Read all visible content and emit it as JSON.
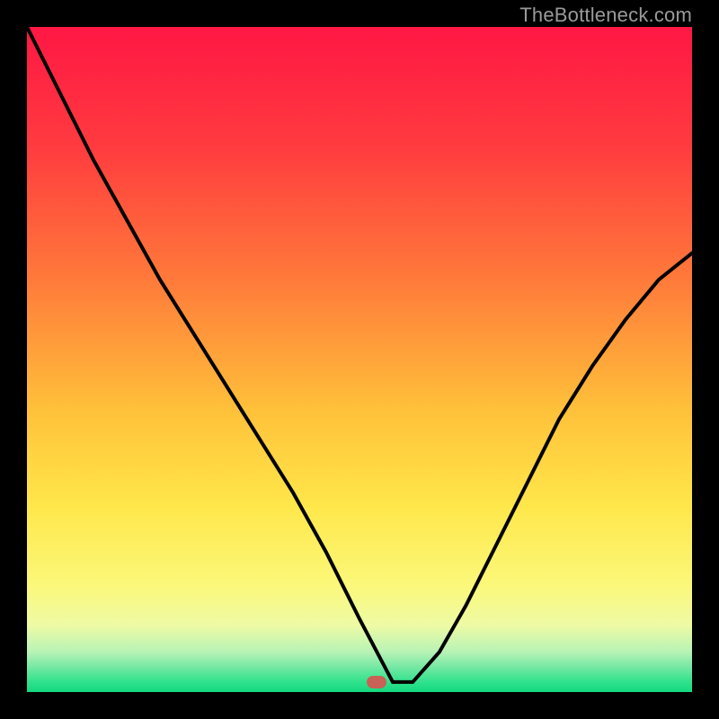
{
  "watermark": {
    "text": "TheBottleneck.com"
  },
  "gradient": {
    "stops": [
      {
        "offset": 0.0,
        "color": "#ff1744"
      },
      {
        "offset": 0.18,
        "color": "#ff3b3f"
      },
      {
        "offset": 0.38,
        "color": "#ff7a3a"
      },
      {
        "offset": 0.58,
        "color": "#ffc23a"
      },
      {
        "offset": 0.72,
        "color": "#ffe74a"
      },
      {
        "offset": 0.84,
        "color": "#fbf87a"
      },
      {
        "offset": 0.9,
        "color": "#eefaa5"
      },
      {
        "offset": 0.94,
        "color": "#b7f3b6"
      },
      {
        "offset": 0.965,
        "color": "#6de7a1"
      },
      {
        "offset": 0.985,
        "color": "#2fe28c"
      },
      {
        "offset": 1.0,
        "color": "#13d97e"
      }
    ]
  },
  "marker": {
    "x_frac": 0.525,
    "y_frac": 0.985
  },
  "chart_data": {
    "type": "line",
    "title": "",
    "xlabel": "",
    "ylabel": "",
    "xlim": [
      0,
      1
    ],
    "ylim": [
      0,
      1
    ],
    "legend_position": "none",
    "grid": false,
    "series": [
      {
        "name": "bottleneck-curve",
        "x": [
          0.0,
          0.05,
          0.1,
          0.15,
          0.2,
          0.25,
          0.3,
          0.35,
          0.4,
          0.45,
          0.5,
          0.55,
          0.58,
          0.62,
          0.66,
          0.7,
          0.75,
          0.8,
          0.85,
          0.9,
          0.95,
          1.0
        ],
        "y": [
          1.0,
          0.9,
          0.8,
          0.71,
          0.62,
          0.54,
          0.46,
          0.38,
          0.3,
          0.21,
          0.11,
          0.015,
          0.015,
          0.06,
          0.13,
          0.21,
          0.31,
          0.41,
          0.49,
          0.56,
          0.62,
          0.66
        ]
      }
    ],
    "annotations": [
      {
        "type": "marker",
        "x": 0.525,
        "y": 0.015,
        "shape": "pill",
        "color": "#c86156"
      }
    ],
    "background": "vertical-gradient"
  }
}
